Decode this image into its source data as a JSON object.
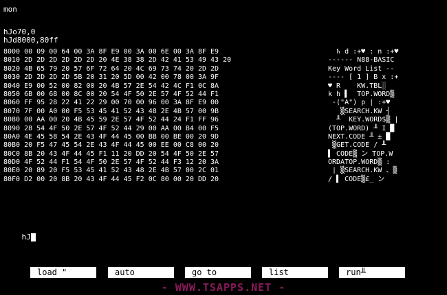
{
  "terminal": {
    "line1": "mon",
    "line2": "hJo70,0",
    "line3": "hJd8000,80ff",
    "dump_rows": [
      "8000 00 09 00 64 00 3A 8F E9 00 3A 00 6E 00 3A 8F E9",
      "8010 2D 2D 2D 2D 2D 2D 20 4E 38 38 2D 42 41 53 49 43 20",
      "8020 4B 65 79 20 57 6F 72 64 20 4C 69 73 74 20 2D 2D",
      "8030 2D 2D 2D 2D 5B 20 31 20 5D 00 42 00 78 00 3A 9F",
      "8040 E9 00 52 00 82 00 20 4B 57 2E 54 42 4C F1 0C 8A",
      "8050 6B 00 68 00 8C 00 20 54 4F 50 2E 57 4F 52 44 F1",
      "8060 FF 95 28 22 41 22 29 00 70 00 96 00 3A 8F E9 00",
      "8070 7F 00 A0 00 F5 53 45 41 52 43 48 2E 4B 57 00 9B",
      "8080 00 AA 00 20 4B 45 59 2E 57 4F 52 44 24 F1 FF 96",
      "8090 28 54 4F 50 2E 57 4F 52 44 29 00 AA 00 B4 00 F5",
      "80A0 4E 45 58 54 2E 43 4F 44 45 00 BB 00 BE 00 20 9D",
      "80B0 20 F5 47 45 54 2E 43 4F 44 45 00 EE 00 C8 00 20",
      "80C0 8B 20 43 4F 44 45 F1 11 20 DD 20 54 4F 50 2E 57",
      "80D0 4F 52 44 F1 54 4F 50 2E 57 4F 52 44 F3 12 20 3A",
      "80E0 20 89 20 F5 53 45 41 52 43 48 2E 4B 57 00 2C 01",
      "80F0 D2 00 20 8B 20 43 4F 44 45 F2 0C 80 00 20 DD 20"
    ],
    "ascii_rows": [
      "  ♄ d :+♥ : n :+♥",
      "------ N88-BASIC",
      "Key Word List --",
      "---- [ 1 ] B x :+",
      "♥ R    KW.TBL░",
      "k h ▌  TOP.WORD▒",
      " -(\"A\") p | :+♥",
      "   ▒SEARCH.KW ┤",
      "  ╨  KEY.WORD$▒ |",
      "(TOP.WORD) ╨ I █",
      "NEXT.CODE ╨ ± █",
      " ▒GET.CODE / ╨",
      "▌ CODE▒ ン TOP.W",
      "ORDATOP.WORD▒ :",
      " | ▒SEARCH.KW 、▒",
      "/ ▌ CODE▒£_ ン"
    ],
    "prompt_line": "hJ"
  },
  "function_keys": {
    "f1": "load \"",
    "f2": "auto",
    "f3": "go to",
    "f4": "list",
    "f5": "run╨"
  },
  "watermark": "- WWW.TSAPPS.NET -",
  "colors": {
    "background": "#000000",
    "text": "#ffffff",
    "watermark": "#8b1a5b"
  }
}
